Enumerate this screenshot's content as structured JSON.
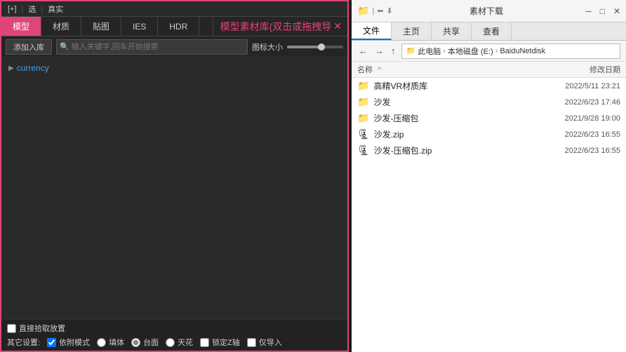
{
  "topBar": {
    "btn1": "[+]",
    "sep1": "|",
    "btn2": "选",
    "sep2": "|",
    "btn3": "真实"
  },
  "tabs": [
    {
      "label": "模型",
      "active": true
    },
    {
      "label": "材质",
      "active": false
    },
    {
      "label": "贴图",
      "active": false
    },
    {
      "label": "IES",
      "active": false
    },
    {
      "label": "HDR",
      "active": false
    }
  ],
  "tabLibrary": {
    "label": "模型素材库(双击或拖拽导",
    "closeIcon": "✕"
  },
  "toolbar": {
    "addBtn": "添加入库",
    "searchPlaceholder": "输入关键字,回车开始搜索",
    "iconSizeLabel": "图标大小"
  },
  "treeItem": {
    "label": "currency"
  },
  "bottomOptions": {
    "checkboxLabel": "直接拾取放置",
    "optionsLabel": "其它设置:",
    "options": [
      {
        "type": "checkbox",
        "label": "依附模式",
        "checked": true
      },
      {
        "type": "radio",
        "label": "填体",
        "value": "tian",
        "checked": false
      },
      {
        "type": "radio",
        "label": "台面",
        "value": "tai",
        "checked": true
      },
      {
        "type": "radio",
        "label": "天花",
        "value": "tian2",
        "checked": false
      },
      {
        "type": "checkbox",
        "label": "锁定Z轴",
        "checked": false
      },
      {
        "type": "checkbox",
        "label": "仅导入",
        "checked": false
      }
    ]
  },
  "explorer": {
    "titleBar": {
      "icons": [
        "📁",
        "|",
        "⬅",
        "⬇"
      ],
      "title": "素材下载"
    },
    "ribbonTabs": [
      "文件",
      "主页",
      "共享",
      "查看"
    ],
    "activeTab": "文件",
    "addressPath": [
      "此电脑",
      "本地磁盘 (E:)",
      "BaiduNetdisk"
    ],
    "colHeaders": {
      "name": "名称",
      "upArrow": "^",
      "date": "修改日期"
    },
    "files": [
      {
        "name": "高精VR材质库",
        "date": "2022/5/11 23:21",
        "type": "folder"
      },
      {
        "name": "沙发",
        "date": "2022/6/23 17:46",
        "type": "folder"
      },
      {
        "name": "沙发-压缩包",
        "date": "2021/9/28 19:00",
        "type": "folder"
      },
      {
        "name": "沙发.zip",
        "date": "2022/6/23 16:55",
        "type": "zip"
      },
      {
        "name": "沙发-压缩包.zip",
        "date": "2022/6/23 16:55",
        "type": "zip"
      }
    ]
  }
}
